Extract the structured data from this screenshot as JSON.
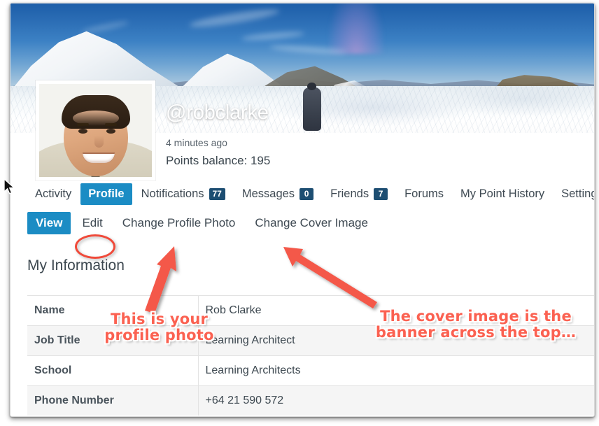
{
  "profile": {
    "username": "@robclarke",
    "last_active": "4 minutes ago",
    "points_balance": "Points balance: 195",
    "avatar_alt": "Rob Clarke profile photo",
    "cover_alt": "Snowy mountain panorama cover image"
  },
  "tabs": [
    {
      "label": "Activity",
      "badge": null,
      "active": false
    },
    {
      "label": "Profile",
      "badge": null,
      "active": true
    },
    {
      "label": "Notifications",
      "badge": "77",
      "active": false
    },
    {
      "label": "Messages",
      "badge": "0",
      "active": false
    },
    {
      "label": "Friends",
      "badge": "7",
      "active": false
    },
    {
      "label": "Forums",
      "badge": null,
      "active": false
    },
    {
      "label": "My Point History",
      "badge": null,
      "active": false
    },
    {
      "label": "Settings",
      "badge": null,
      "active": false
    }
  ],
  "subnav": [
    {
      "label": "View",
      "active": true
    },
    {
      "label": "Edit",
      "active": false
    },
    {
      "label": "Change Profile Photo",
      "active": false
    },
    {
      "label": "Change Cover Image",
      "active": false
    }
  ],
  "section": {
    "title": "My Information"
  },
  "info_table": {
    "rows": [
      {
        "label": "Name",
        "value": "Rob Clarke"
      },
      {
        "label": "Job Title",
        "value": "Learning Architect"
      },
      {
        "label": "School",
        "value": "Learning Architects"
      },
      {
        "label": "Phone Number",
        "value": "+64 21 590 572"
      }
    ]
  },
  "annotations": {
    "profile_photo_note_line1": "This is your",
    "profile_photo_note_line2": "profile photo",
    "cover_note_line1": "The cover image is the",
    "cover_note_line2": "banner across the top…",
    "highlight_target": "Edit"
  },
  "colors": {
    "accent_blue": "#1b8cc4",
    "badge_navy": "#1d4e72",
    "annotation_red": "#fb6151",
    "ellipse_red": "#f04a3a",
    "row_alt": "#f5f5f5",
    "text_dark": "#3d4850"
  }
}
